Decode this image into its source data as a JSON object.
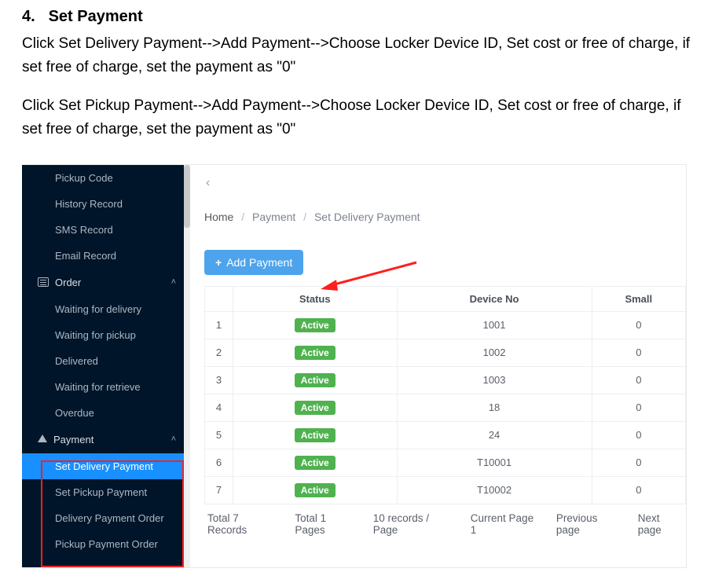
{
  "doc": {
    "section_number": "4.",
    "section_title": "Set Payment",
    "paragraph1": "Click Set Delivery Payment-->Add Payment-->Choose Locker Device ID, Set cost or free of charge, if set free of charge, set the payment as \"0\"",
    "paragraph2": "Click Set Pickup Payment-->Add Payment-->Choose Locker Device ID, Set cost or free of charge, if set free of charge, set the payment as \"0\""
  },
  "sidebar": {
    "items_top": [
      "Pickup Code",
      "History Record",
      "SMS Record",
      "Email Record"
    ],
    "order_header": "Order",
    "order_items": [
      "Waiting for delivery",
      "Waiting for pickup",
      "Delivered",
      "Waiting for retrieve",
      "Overdue"
    ],
    "payment_header": "Payment",
    "payment_items": [
      "Set Delivery Payment",
      "Set Pickup Payment",
      "Delivery Payment Order",
      "Pickup Payment Order"
    ],
    "active_payment_index": 0
  },
  "breadcrumb": {
    "home": "Home",
    "mid": "Payment",
    "leaf": "Set Delivery Payment"
  },
  "buttons": {
    "add_payment": "Add Payment"
  },
  "table": {
    "headers": {
      "status": "Status",
      "device_no": "Device No",
      "small": "Small"
    },
    "rows": [
      {
        "idx": "1",
        "status": "Active",
        "device": "1001",
        "small": "0"
      },
      {
        "idx": "2",
        "status": "Active",
        "device": "1002",
        "small": "0"
      },
      {
        "idx": "3",
        "status": "Active",
        "device": "1003",
        "small": "0"
      },
      {
        "idx": "4",
        "status": "Active",
        "device": "18",
        "small": "0"
      },
      {
        "idx": "5",
        "status": "Active",
        "device": "24",
        "small": "0"
      },
      {
        "idx": "6",
        "status": "Active",
        "device": "T10001",
        "small": "0"
      },
      {
        "idx": "7",
        "status": "Active",
        "device": "T10002",
        "small": "0"
      }
    ]
  },
  "pager": {
    "total_records": "Total 7 Records",
    "total_pages": "Total 1 Pages",
    "page_size": "10 records / Page",
    "current": "Current Page 1",
    "prev": "Previous page",
    "next": "Next page"
  },
  "colors": {
    "sidebar_bg": "#001529",
    "accent_blue": "#1890ff",
    "button_blue": "#4ea4ec",
    "badge_green": "#4fb24f",
    "highlight_red": "#ff1e1e"
  }
}
